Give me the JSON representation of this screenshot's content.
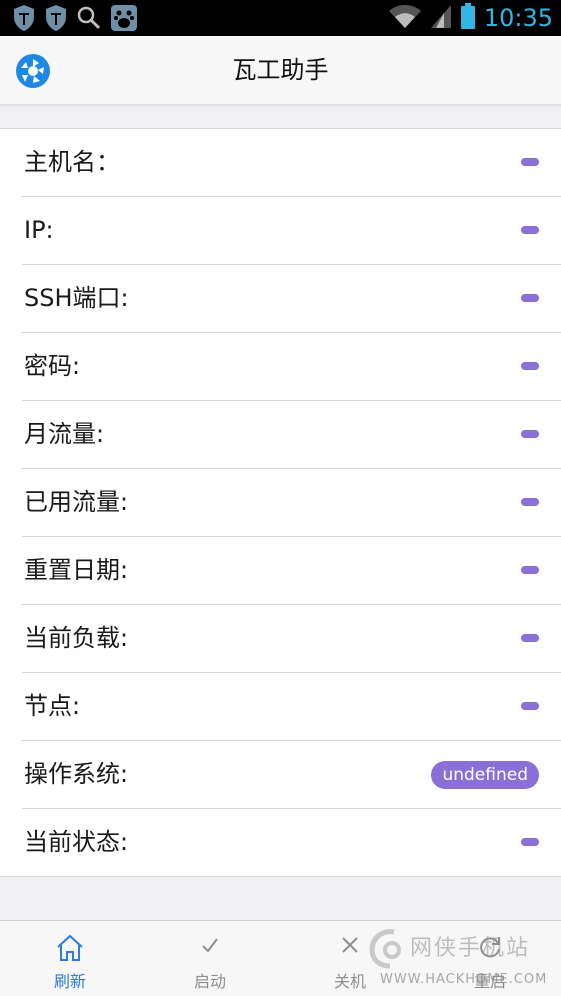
{
  "status_bar": {
    "time": "10:35",
    "icons": [
      "shield-icon",
      "shield-icon",
      "search-icon",
      "baidu-icon",
      "wifi-icon",
      "signal-icon",
      "battery-icon"
    ]
  },
  "header": {
    "title": "瓦工助手",
    "logo_icon": "aperture-logo-icon"
  },
  "info": {
    "rows": [
      {
        "label": "主机名：",
        "value": ""
      },
      {
        "label": "IP:",
        "value": ""
      },
      {
        "label": "SSH端口:",
        "value": ""
      },
      {
        "label": "密码:",
        "value": ""
      },
      {
        "label": "月流量:",
        "value": ""
      },
      {
        "label": "已用流量:",
        "value": ""
      },
      {
        "label": "重置日期:",
        "value": ""
      },
      {
        "label": "当前负载:",
        "value": ""
      },
      {
        "label": "节点:",
        "value": ""
      },
      {
        "label": "操作系统:",
        "value": "undefined"
      },
      {
        "label": "当前状态:",
        "value": ""
      }
    ]
  },
  "tabs": [
    {
      "label": "刷新",
      "icon": "home-icon",
      "active": true
    },
    {
      "label": "启动",
      "icon": "check-icon",
      "active": false
    },
    {
      "label": "关机",
      "icon": "close-icon",
      "active": false
    },
    {
      "label": "重启",
      "icon": "restart-icon",
      "active": false
    }
  ],
  "watermark": {
    "cn": "网侠手机站",
    "en": "WWW.HACKHOME.COM"
  },
  "colors": {
    "accent": "#8a6fd6",
    "tab_active": "#2c7be5",
    "status_icons": "#33b5e5"
  }
}
